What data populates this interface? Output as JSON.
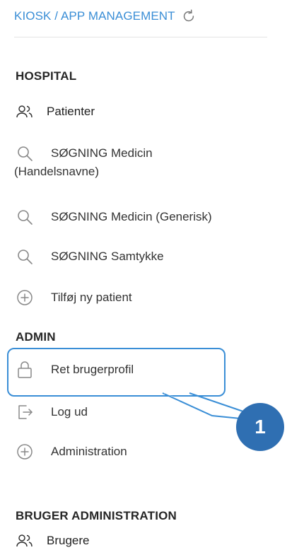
{
  "header": {
    "title": "KIOSK / APP MANAGEMENT",
    "refresh_icon": "refresh-icon"
  },
  "sections": {
    "hospital": "HOSPITAL",
    "admin": "ADMIN",
    "user_admin": "BRUGER ADMINISTRATION"
  },
  "hospital_items": {
    "patients": "Patienter",
    "search_trade_line1": "SØGNING Medicin",
    "search_trade_line2": "(Handelsnavne)",
    "search_generic": "SØGNING Medicin (Generisk)",
    "search_consent": "SØGNING Samtykke",
    "add_patient": "Tilføj ny patient"
  },
  "admin_items": {
    "edit_profile": "Ret brugerprofil",
    "logout": "Log ud",
    "administration": "Administration"
  },
  "user_admin_items": {
    "users": "Brugere"
  },
  "callout": {
    "number": "1",
    "color": "#2f6fb2",
    "outline_color": "#3a8ed6"
  }
}
